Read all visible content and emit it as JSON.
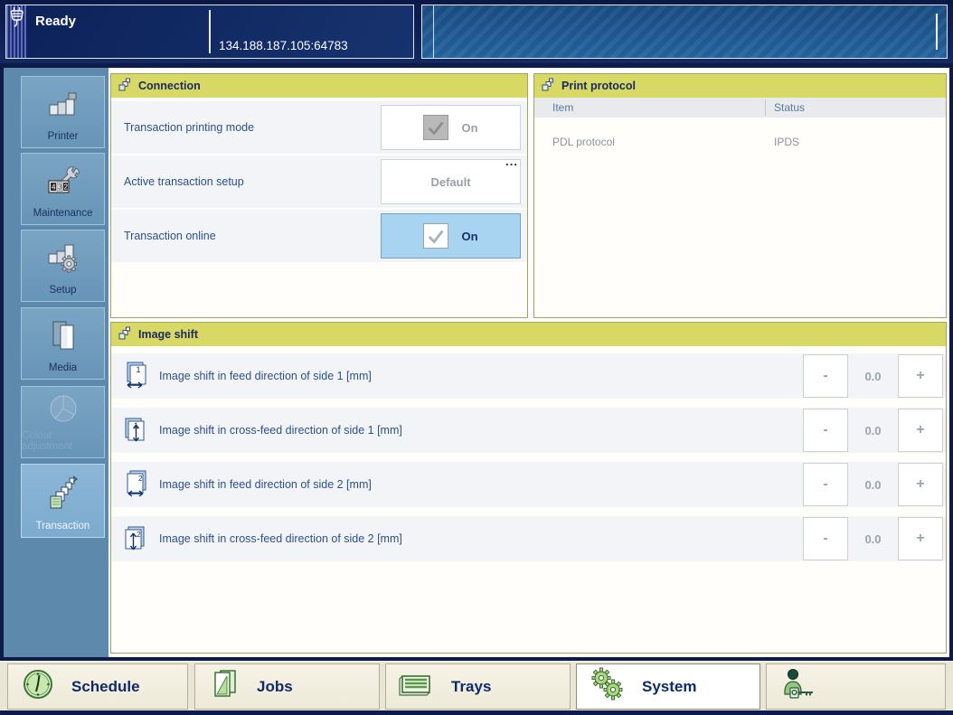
{
  "top_bar": {
    "status": "Ready",
    "address": "134.188.187.105:64783"
  },
  "sidebar": {
    "items": [
      {
        "label": "Printer",
        "state": "normal"
      },
      {
        "label": "Maintenance",
        "state": "normal"
      },
      {
        "label": "Setup",
        "state": "normal"
      },
      {
        "label": "Media",
        "state": "normal"
      },
      {
        "label": "Colour adjustment",
        "state": "disabled"
      },
      {
        "label": "Transaction",
        "state": "selected"
      }
    ]
  },
  "connection_panel": {
    "title": "Connection",
    "rows": [
      {
        "label": "Transaction printing mode",
        "control": "checkbox-readonly",
        "value": "On"
      },
      {
        "label": "Active transaction setup",
        "control": "button",
        "value": "Default",
        "more": "..."
      },
      {
        "label": "Transaction online",
        "control": "checkbox-selected",
        "value": "On"
      }
    ]
  },
  "print_protocol_panel": {
    "title": "Print protocol",
    "columns": [
      "Item",
      "Status"
    ],
    "rows": [
      {
        "item": "PDL protocol",
        "status": "IPDS"
      }
    ]
  },
  "image_shift_panel": {
    "title": "Image shift",
    "minus_label": "-",
    "plus_label": "+",
    "rows": [
      {
        "label": "Image shift in feed direction of side 1 [mm]",
        "value": "0.0"
      },
      {
        "label": "Image shift in cross-feed direction of side 1 [mm]",
        "value": "0.0"
      },
      {
        "label": "Image shift in feed direction of side 2 [mm]",
        "value": "0.0"
      },
      {
        "label": "Image shift in cross-feed direction of side 2 [mm]",
        "value": "0.0"
      }
    ]
  },
  "bottom_bar": {
    "tabs": [
      {
        "label": "Schedule",
        "icon": "clock-icon",
        "active": false
      },
      {
        "label": "Jobs",
        "icon": "documents-icon",
        "active": false
      },
      {
        "label": "Trays",
        "icon": "tray-icon",
        "active": false
      },
      {
        "label": "System",
        "icon": "gears-icon",
        "active": true
      },
      {
        "label": "",
        "icon": "operator-key-icon",
        "active": false
      }
    ]
  },
  "colors": {
    "frame_navy": "#0d1b4b",
    "sidebar_blue": "#5d8aac",
    "panel_header_yellow": "#d8d964",
    "highlight_blue": "#a9d4f1",
    "label_blue": "#2d4f8e",
    "bottombar_beige": "#e9e6d5",
    "icon_green": "#9ccc70"
  }
}
